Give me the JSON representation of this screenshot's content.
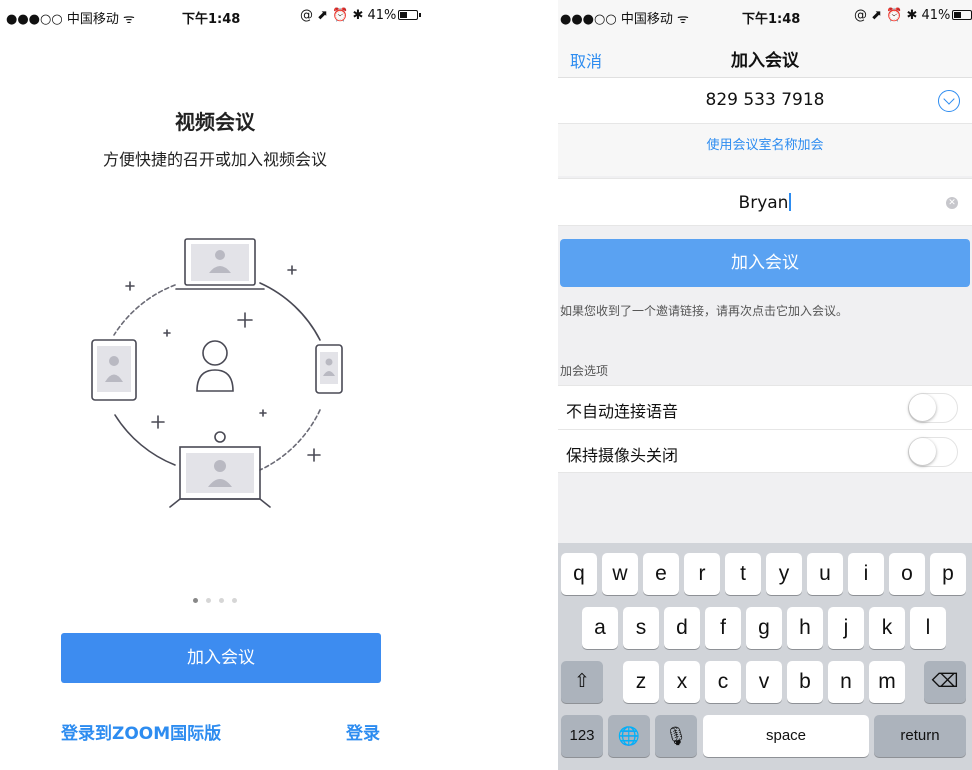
{
  "left_screen": {
    "status": {
      "carrier": "●●●○○ 中国移动 ᯤ",
      "time": "下午1:48",
      "right": "@ ⬈ ⏰ ✱ 41%"
    },
    "title": "视频会议",
    "subtitle": "方便快捷的召开或加入视频会议",
    "page_dots": {
      "count": 4,
      "active_index": 0
    },
    "join_button": "加入会议",
    "intl_link": "登录到ZOOM国际版",
    "login_link": "登录"
  },
  "right_screen": {
    "status": {
      "carrier": "●●●○○ 中国移动 ᯤ",
      "time": "下午1:48",
      "right": "@ ⬈ ⏰ ✱ 41%"
    },
    "nav": {
      "cancel": "取消",
      "title": "加入会议"
    },
    "meeting_id": "829 533 7918",
    "join_by_room_name": "使用会议室名称加会",
    "name_value": "Bryan",
    "join_button": "加入会议",
    "hint": "如果您收到了一个邀请链接，请再次点击它加入会议。",
    "section_label": "加会选项",
    "options": [
      {
        "label": "不自动连接语音",
        "on": false
      },
      {
        "label": "保持摄像头关闭",
        "on": false
      }
    ],
    "keyboard": {
      "row1": [
        "q",
        "w",
        "e",
        "r",
        "t",
        "y",
        "u",
        "i",
        "o",
        "p"
      ],
      "row2": [
        "a",
        "s",
        "d",
        "f",
        "g",
        "h",
        "j",
        "k",
        "l"
      ],
      "row3": [
        "z",
        "x",
        "c",
        "v",
        "b",
        "n",
        "m"
      ],
      "shift": "⇧",
      "backspace": "⌫",
      "num": "123",
      "globe": "🌐",
      "mic": "🎙",
      "space": "space",
      "return": "return"
    }
  },
  "colors": {
    "accent": "#2d8cf0",
    "button_left": "#3d8cf0",
    "button_right": "#5aa2f2",
    "keyboard_bg": "#d1d4d9"
  }
}
